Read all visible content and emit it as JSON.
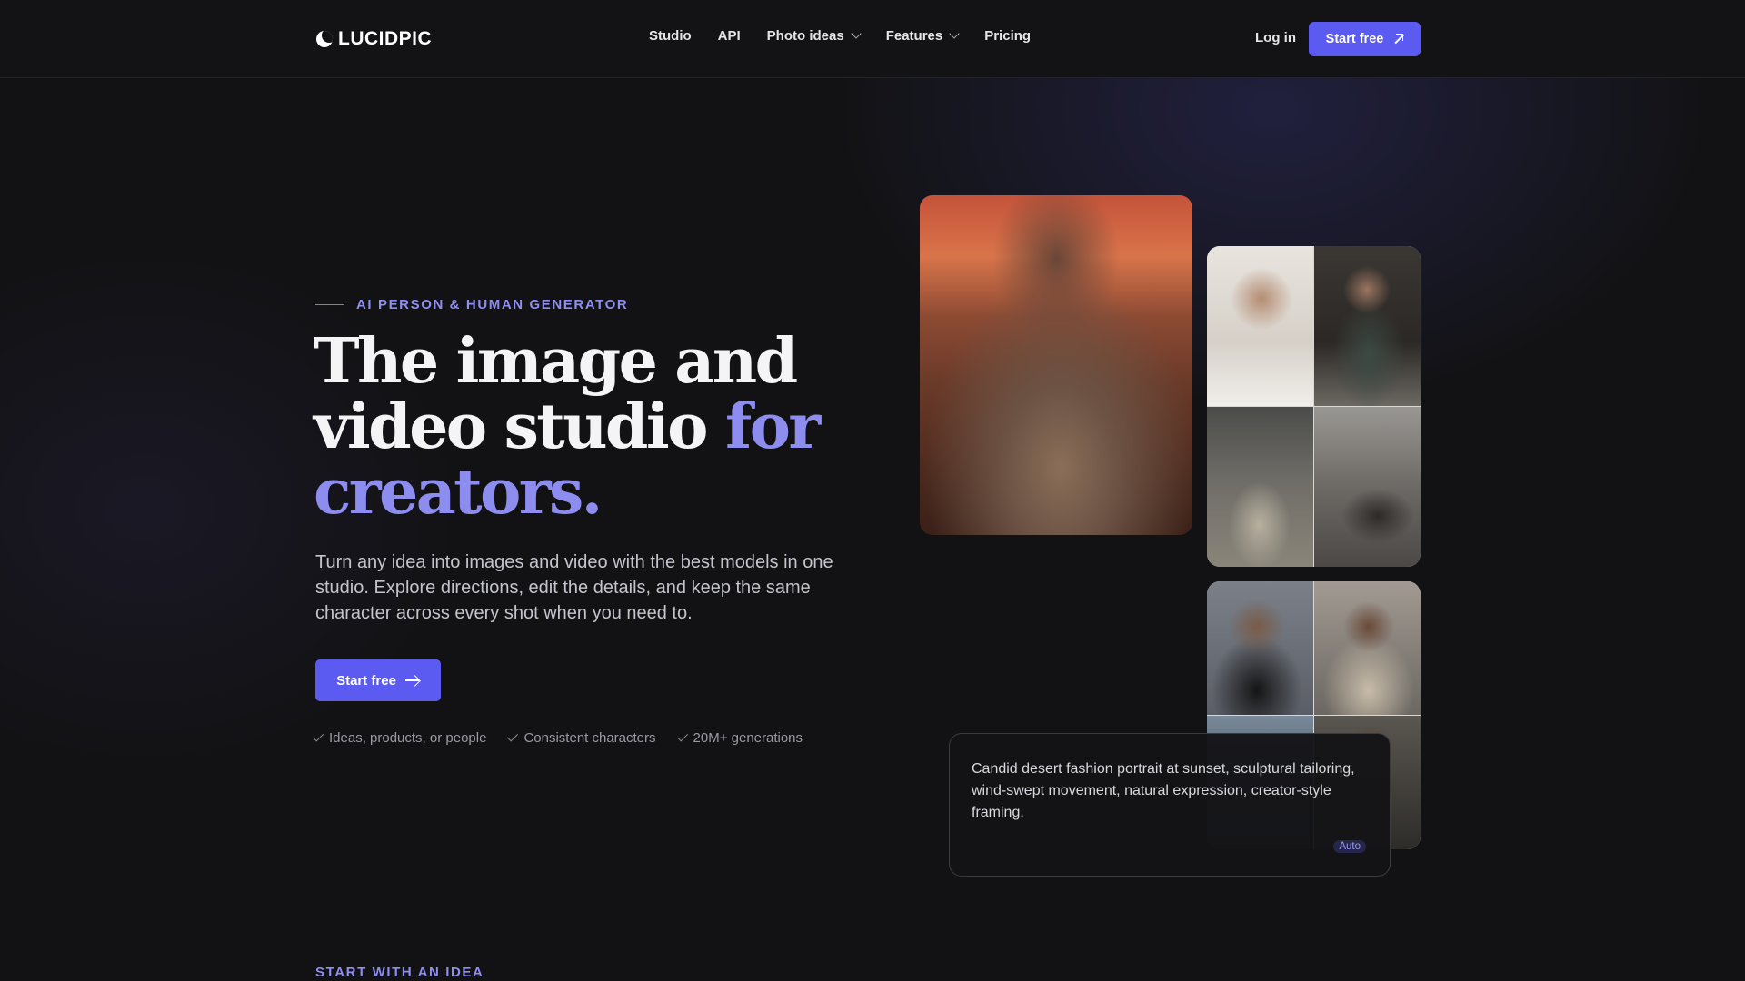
{
  "nav": {
    "logo_text": "LUCIDPIC",
    "links": [
      {
        "label": "Studio",
        "has_dropdown": false
      },
      {
        "label": "API",
        "has_dropdown": false
      },
      {
        "label": "Photo ideas",
        "has_dropdown": true
      },
      {
        "label": "Features",
        "has_dropdown": true
      },
      {
        "label": "Pricing",
        "has_dropdown": false
      }
    ],
    "login_label": "Log in",
    "cta_label": "Start free"
  },
  "hero": {
    "eyebrow": "AI PERSON & HUMAN GENERATOR",
    "headline_line1": "The image and",
    "headline_line2_plain": "video studio ",
    "headline_line2_accent": "for",
    "headline_line3_accent": "creators.",
    "subtext": "Turn any idea into images and video with the best models in one studio. Explore directions, edit the details, and keep the same character across every shot when you need to.",
    "cta_label": "Start free",
    "checks": [
      "Ideas, products, or people",
      "Consistent characters",
      "20M+ generations"
    ]
  },
  "prompt_card": {
    "text": "Candid desert fashion portrait at sunset, sculptural tailoring, wind-swept movement, natural expression, creator-style framing.",
    "badge": "Auto"
  },
  "next_section": {
    "label": "START WITH AN IDEA"
  },
  "colors": {
    "background": "#121214",
    "accent": "#5b5bf2",
    "accent_text": "#8d8df0"
  }
}
